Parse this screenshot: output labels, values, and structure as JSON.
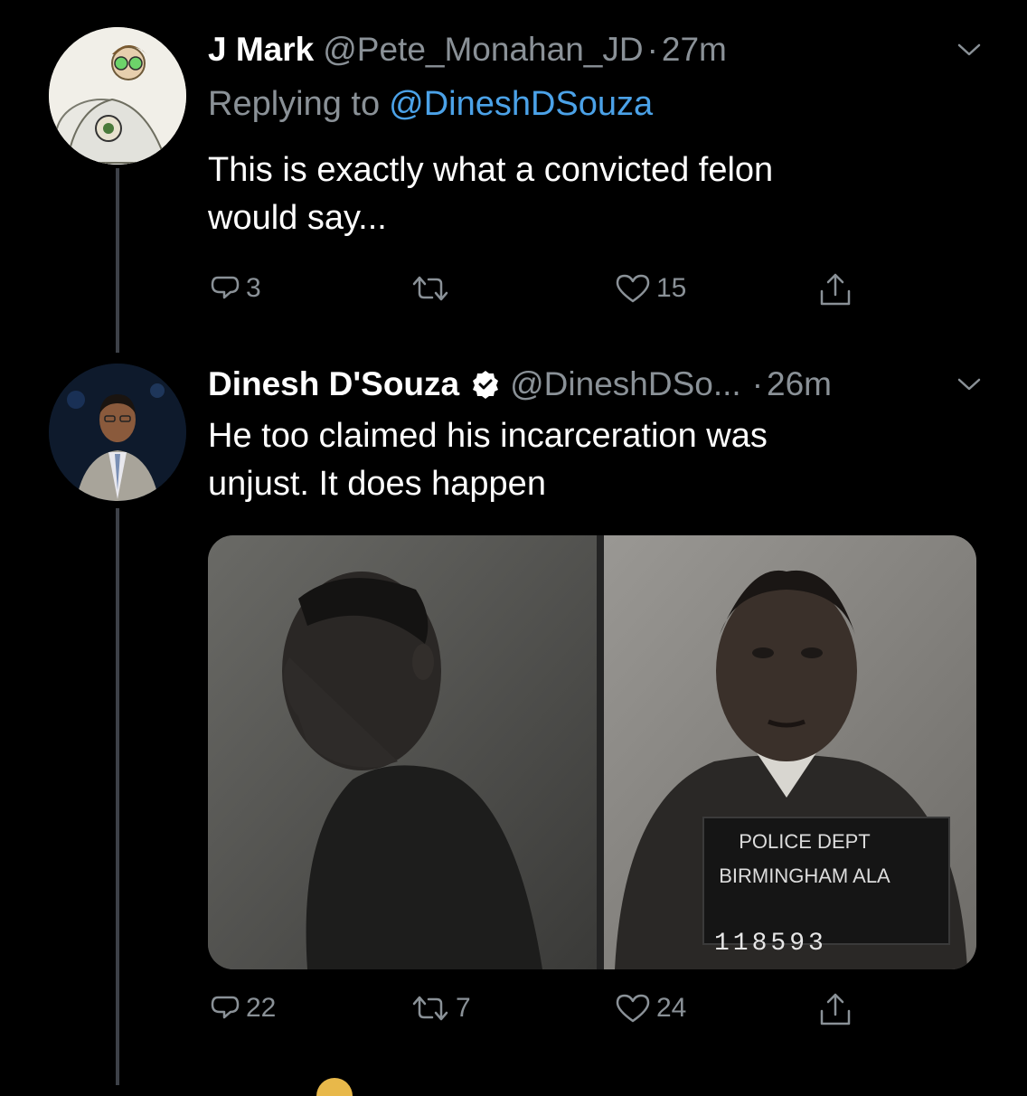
{
  "tweets": [
    {
      "name": "J Mark",
      "handle": "@Pete_Monahan_JD",
      "separator": "·",
      "time": "27m",
      "replying_label": "Replying to",
      "replying_handle": "@DineshDSouza",
      "text_lines": [
        "This is exactly what a convicted felon",
        "would say..."
      ],
      "replies": "3",
      "retweets": "",
      "likes": "15"
    },
    {
      "name": "Dinesh D'Souza",
      "verified": true,
      "handle": "@DineshDSo...",
      "separator": "·",
      "time": "26m",
      "text_lines": [
        "He too claimed his incarceration was",
        "unjust. It does happen"
      ],
      "media": {
        "placard_line1": "POLICE DEPT",
        "placard_line2": "BIRMINGHAM ALA",
        "placard_number": "118593"
      },
      "replies": "22",
      "retweets": "7",
      "likes": "24"
    }
  ],
  "colors": {
    "background": "#000000",
    "text": "#ffffff",
    "muted": "#8a9197",
    "link": "#4ba2e8",
    "thread_line": "#3d4148"
  },
  "icons": [
    "reply-icon",
    "retweet-icon",
    "like-icon",
    "share-icon",
    "chevron-down-icon",
    "verified-badge-icon"
  ]
}
